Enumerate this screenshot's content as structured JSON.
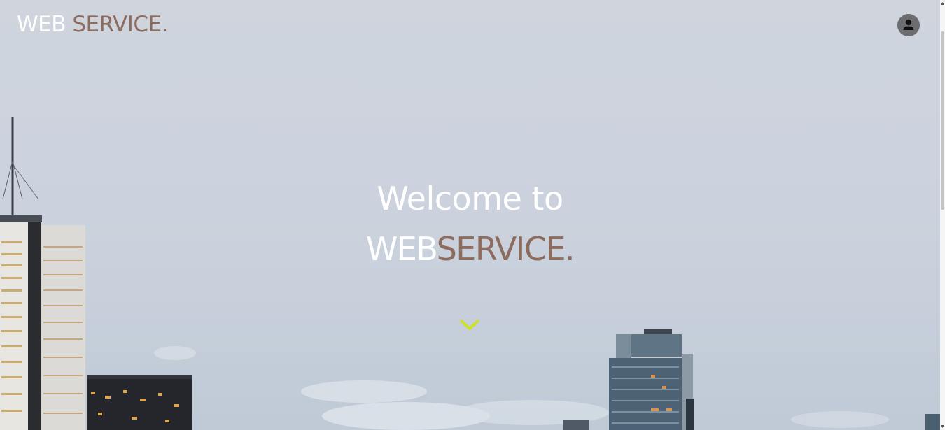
{
  "header": {
    "logo_web": "WEB",
    "logo_service": "SERVICE."
  },
  "hero": {
    "welcome_text": "Welcome to",
    "brand_web": "WEB",
    "brand_service": "SERVICE."
  },
  "icons": {
    "account": "account-icon",
    "scroll_down": "chevron-down-icon"
  },
  "colors": {
    "sky": "#cdd3de",
    "brand_accent": "#8d6c60",
    "chevron": "#cde02a",
    "avatar_bg": "#6d6d70"
  }
}
